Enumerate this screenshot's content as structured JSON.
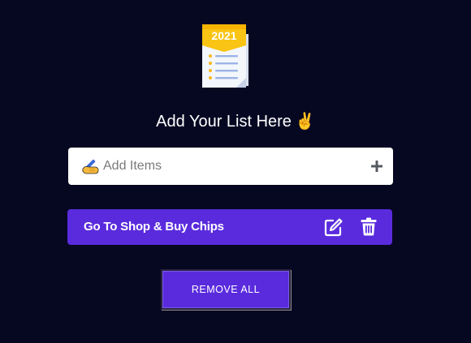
{
  "logo": {
    "year": "2021",
    "icon": "notepad-icon"
  },
  "header": {
    "title": "Add Your List Here",
    "emoji": "✌️"
  },
  "add_input": {
    "placeholder": "Add Items",
    "value": "",
    "icons": {
      "leading": "writing-hand-icon",
      "action": "plus-icon"
    }
  },
  "items": [
    {
      "label": "Go To Shop & Buy Chips",
      "icons": [
        "edit-icon",
        "trash-icon"
      ]
    }
  ],
  "actions": {
    "remove_all_label": "REMOVE ALL"
  },
  "colors": {
    "background": "#060822",
    "accent": "#5a2bdd",
    "input_bg": "#ffffff",
    "text": "#ffffff"
  }
}
